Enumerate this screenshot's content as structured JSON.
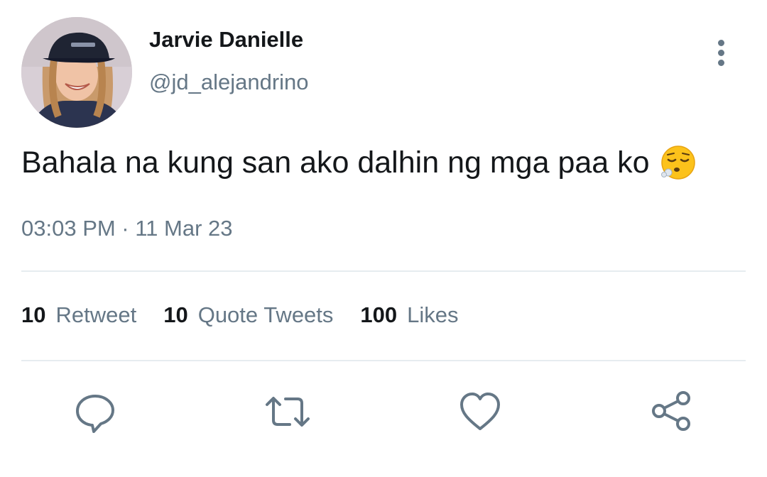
{
  "tweet": {
    "author": {
      "display_name": "Jarvie Danielle",
      "handle": "@jd_alejandrino"
    },
    "text": "Bahala na kung san ako dalhin ng mga paa ko",
    "emoji": "face-exhaling-emoji",
    "timestamp": "03:03 PM · 11 Mar 23",
    "stats": [
      {
        "count": "10",
        "label": "Retweet"
      },
      {
        "count": "10",
        "label": "Quote Tweets"
      },
      {
        "count": "100",
        "label": "Likes"
      }
    ],
    "actions": [
      "reply-icon",
      "retweet-icon",
      "like-icon",
      "share-icon"
    ]
  },
  "colors": {
    "text_primary": "#14171a",
    "text_secondary": "#657786",
    "divider": "#e6ecf0",
    "icon": "#657786"
  }
}
